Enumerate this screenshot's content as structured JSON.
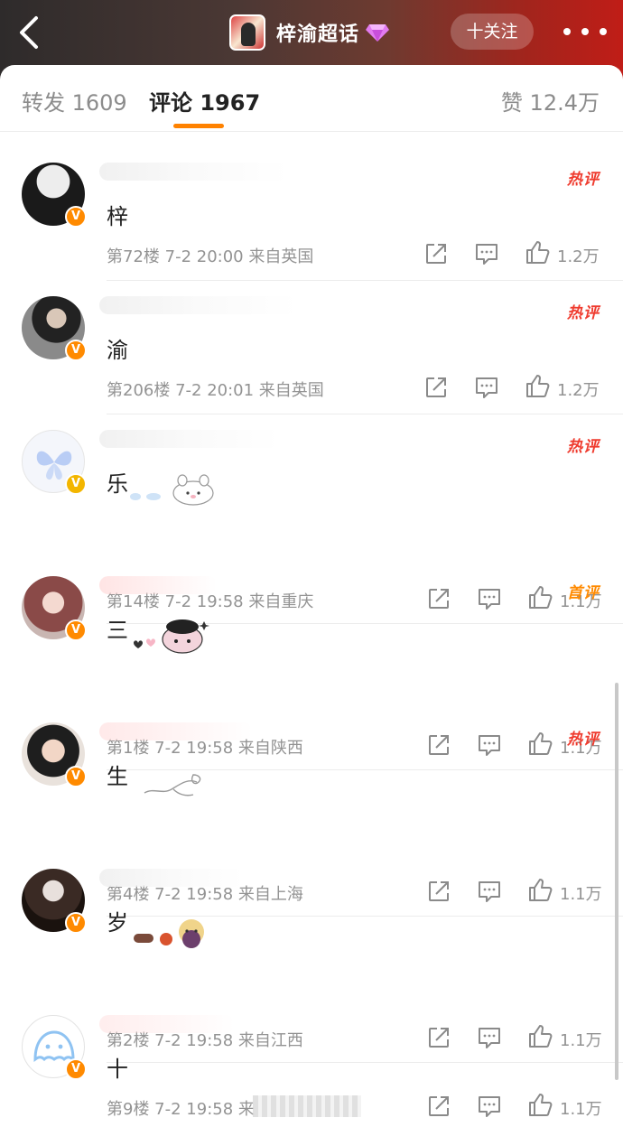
{
  "header": {
    "title": "梓渝超话",
    "follow_label": "十关注",
    "back_icon": "chevron-left-icon",
    "more_icon": "more-dots-icon",
    "gem_icon": "diamond-icon"
  },
  "tabs": {
    "repost": "转发 1609",
    "comment": "评论 1967",
    "like": "赞 12.4万"
  },
  "colors": {
    "accent": "#ff8200",
    "hot_tag": "#ef3b2e",
    "first_tag": "#ff8a00",
    "verified_badge": "#ff8a00"
  },
  "comments": [
    {
      "tag": "热评",
      "text": "梓",
      "meta": "第72楼 7-2 20:00 来自英国",
      "likes": "1.2万"
    },
    {
      "tag": "热评",
      "text": "渝",
      "meta": "第206楼 7-2 20:01 来自英国",
      "likes": "1.2万"
    },
    {
      "tag": "热评",
      "text": "乐",
      "meta": "第14楼 7-2 19:58 来自重庆",
      "likes": "1.1万"
    },
    {
      "tag": "首评",
      "text": "三",
      "meta": "第1楼 7-2 19:58 来自陕西",
      "likes": "1.1万"
    },
    {
      "tag": "热评",
      "text": "生",
      "meta": "第4楼 7-2 19:58 来自上海",
      "likes": "1.1万"
    },
    {
      "tag": "",
      "text": "岁",
      "meta": "第2楼 7-2 19:58 来自江西",
      "likes": "1.1万"
    },
    {
      "tag": "",
      "text": "十",
      "meta": "第9楼 7-2 19:58 来",
      "likes": "1.1万"
    }
  ]
}
